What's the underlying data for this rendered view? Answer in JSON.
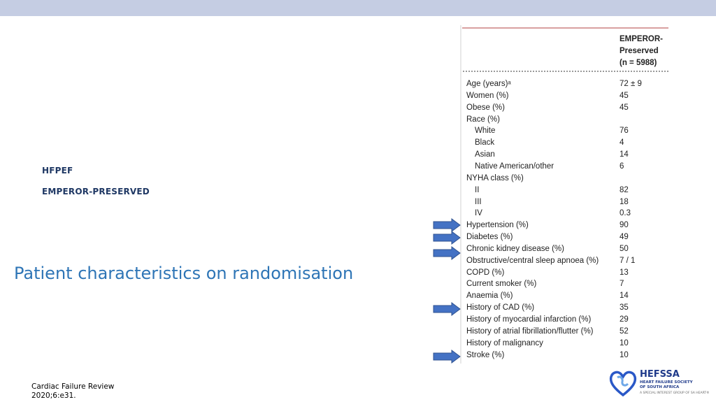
{
  "slide": {
    "label_1": "HFPEF",
    "label_2": "EMPEROR-PRESERVED",
    "title": "Patient characteristics on randomisation",
    "citation_line1": "Cardiac Failure Review",
    "citation_line2": "2020;6:e31."
  },
  "table": {
    "header_line1": "EMPEROR-",
    "header_line2": "Preserved",
    "header_line3": "(n = 5988)",
    "rows": [
      {
        "label": "Age (years)ᵃ",
        "value": "72 ± 9"
      },
      {
        "label": "Women (%)",
        "value": "45"
      },
      {
        "label": "Obese (%)",
        "value": "45"
      },
      {
        "label": "Race (%)",
        "value": ""
      },
      {
        "label": "White",
        "value": "76"
      },
      {
        "label": "Black",
        "value": "4"
      },
      {
        "label": "Asian",
        "value": "14"
      },
      {
        "label": "Native American/other",
        "value": "6"
      },
      {
        "label": "NYHA class (%)",
        "value": ""
      },
      {
        "label": "II",
        "value": "82"
      },
      {
        "label": "III",
        "value": "18"
      },
      {
        "label": "IV",
        "value": "0.3"
      },
      {
        "label": "Hypertension (%)",
        "value": "90"
      },
      {
        "label": "Diabetes (%)",
        "value": "49"
      },
      {
        "label": "Chronic kidney disease (%)",
        "value": "50"
      },
      {
        "label": "Obstructive/central sleep apnoea (%)",
        "value": "7 / 1"
      },
      {
        "label": "COPD (%)",
        "value": "13"
      },
      {
        "label": "Current smoker (%)",
        "value": "7"
      },
      {
        "label": "Anaemia (%)",
        "value": "14"
      },
      {
        "label": "History of CAD (%)",
        "value": "35"
      },
      {
        "label": "History of myocardial infarction (%)",
        "value": "29"
      },
      {
        "label": "History of atrial fibrillation/flutter (%)",
        "value": "52"
      },
      {
        "label": "History of malignancy",
        "value": "10"
      },
      {
        "label": "Stroke (%)",
        "value": "10"
      }
    ]
  },
  "logo": {
    "name": "HEFSSA",
    "subtitle": "HEART FAILURE SOCIETY OF SOUTH AFRICA",
    "tagline": "A SPECIAL INTEREST GROUP OF SA HEART®"
  },
  "colors": {
    "top_bar": "#c5cde3",
    "title": "#2e75b6",
    "label": "#1f3864",
    "arrow": "#4472c4"
  },
  "icons": [
    "arrow-right-icon",
    "heart-logo-icon"
  ]
}
